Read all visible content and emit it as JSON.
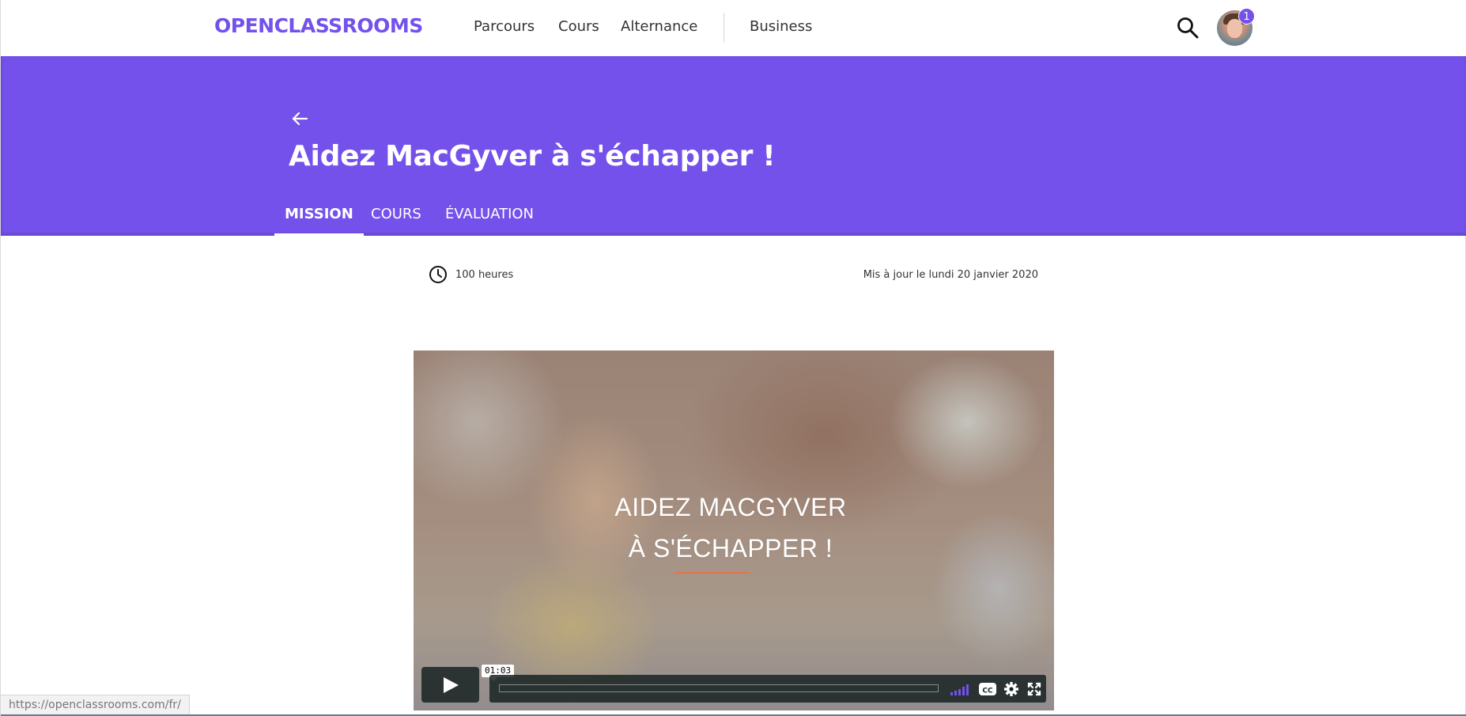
{
  "nav": {
    "logo_text": "OPENCLASSROOMS",
    "links": [
      "Parcours",
      "Cours",
      "Alternance"
    ],
    "business_label": "Business",
    "search_icon": "search-icon",
    "notification_count": "1"
  },
  "hero": {
    "back_icon": "arrow-left-icon",
    "title": "Aidez MacGyver à s'échapper !",
    "tabs": [
      {
        "label": "MISSION",
        "active": true
      },
      {
        "label": "COURS",
        "active": false
      },
      {
        "label": "ÉVALUATION",
        "active": false
      }
    ]
  },
  "meta": {
    "duration_icon": "clock-icon",
    "duration": "100 heures",
    "updated": "Mis à jour le lundi 20 janvier 2020"
  },
  "video": {
    "title_line1": "AIDEZ MACGYVER",
    "title_line2": "À S'ÉCHAPPER !",
    "duration_tooltip": "01:03",
    "progress_fraction": 0,
    "controls": [
      "play-icon",
      "volume-icon",
      "closed-captions-icon",
      "settings-icon",
      "fullscreen-icon"
    ]
  },
  "status_url": "https://openclassrooms.com/fr/",
  "colors": {
    "brand": "#7451eb",
    "video_control_bg": "#172322",
    "accent_underline": "#e2744b"
  }
}
